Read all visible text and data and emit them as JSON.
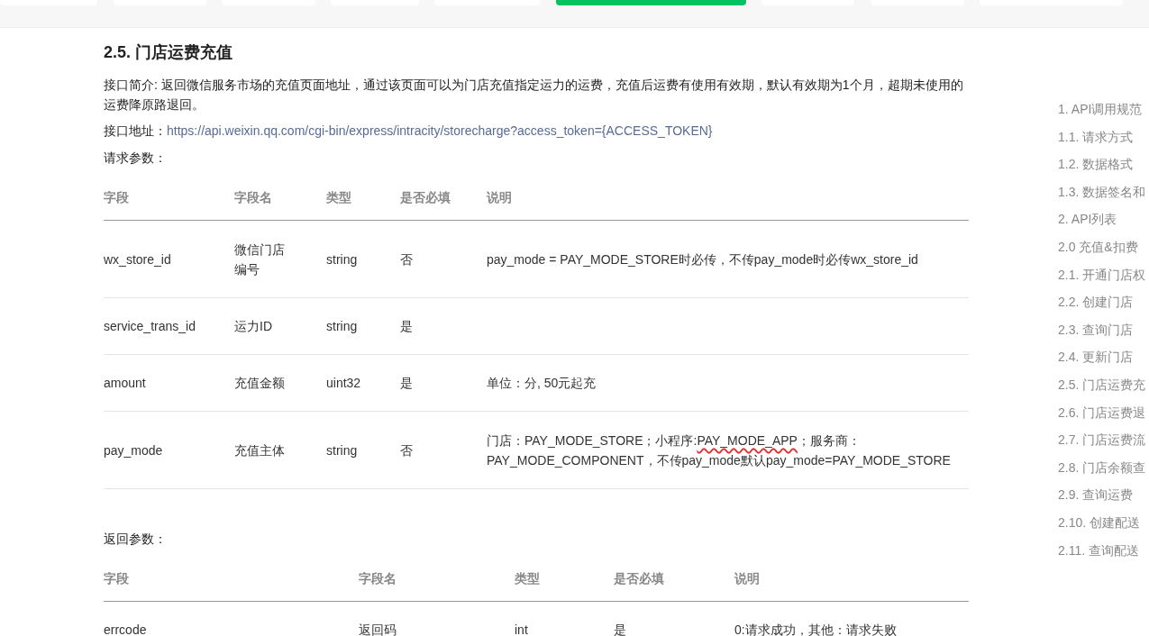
{
  "top_tabs": [
    {
      "selected": false
    },
    {
      "selected": false
    },
    {
      "selected": false
    },
    {
      "selected": false
    },
    {
      "selected": false
    },
    {
      "selected": true
    },
    {
      "selected": false
    },
    {
      "selected": false
    },
    {
      "selected": false
    }
  ],
  "section": {
    "title": "2.5. 门店运费充值",
    "intro": "接口简介: 返回微信服务市场的充值页面地址，通过该页面可以为门店充值指定运力的运费，充值后运费有使用有效期，默认有效期为1个月，超期未使用的运费降原路退回。",
    "address_label": "接口地址：",
    "address_url": "https://api.weixin.qq.com/cgi-bin/express/intracity/storecharge?access_token={ACCESS_TOKEN}",
    "request_label": "请求参数：",
    "request_table": {
      "columns": [
        "字段",
        "字段名",
        "类型",
        "是否必填",
        "说明"
      ],
      "rows": [
        {
          "cells": [
            "wx_store_id",
            "微信门店编号",
            "string",
            "否"
          ],
          "description": [
            {
              "text": "pay_mode = PAY_MODE_STORE时必传，不传pay_mode时必传wx_store_id",
              "marked": false
            }
          ]
        },
        {
          "cells": [
            "service_trans_id",
            "运力ID",
            "string",
            "是"
          ],
          "description": []
        },
        {
          "cells": [
            "amount",
            "充值金额",
            "uint32",
            "是"
          ],
          "description": [
            {
              "text": "单位：分, 50元起充",
              "marked": false
            }
          ]
        },
        {
          "cells": [
            "pay_mode",
            "充值主体",
            "string",
            "否"
          ],
          "description": [
            {
              "text": "门店：PAY_MODE_STORE；小程序:",
              "marked": false
            },
            {
              "text": "PAY_MODE_APP",
              "marked": true
            },
            {
              "text": "；服务商：PAY_MODE_COMPONENT，不传pay_mode默认pay_mode=PAY_MODE_STORE",
              "marked": false
            }
          ]
        }
      ]
    },
    "response_label": "返回参数：",
    "response_table": {
      "columns": [
        "字段",
        "字段名",
        "类型",
        "是否必填",
        "说明"
      ],
      "rows": [
        {
          "cells": [
            "errcode",
            "返回码",
            "int",
            "是",
            "0:请求成功，其他：请求失败"
          ]
        }
      ]
    }
  },
  "toc": [
    "1. API调用规范",
    "1.1. 请求方式",
    "1.2. 数据格式",
    "1.3. 数据签名和",
    "2. API列表",
    "2.0 充值&扣费",
    "2.1. 开通门店权",
    "2.2. 创建门店",
    "2.3. 查询门店",
    "2.4. 更新门店",
    "2.5. 门店运费充",
    "2.6. 门店运费退",
    "2.7. 门店运费流",
    "2.8. 门店余额查",
    "2.9. 查询运费",
    "2.10. 创建配送",
    "2.11. 查询配送"
  ]
}
